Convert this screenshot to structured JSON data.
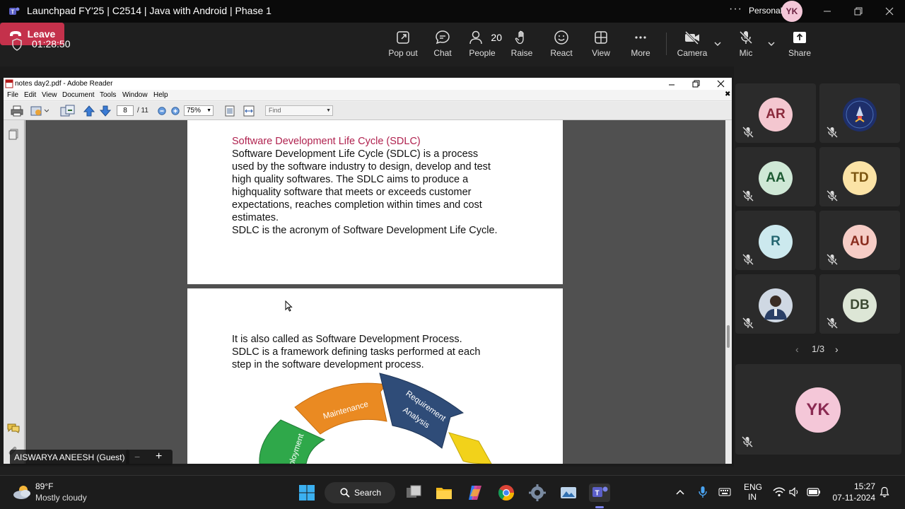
{
  "window": {
    "title": "Launchpad FY'25 | C2514 | Java with Android | Phase 1",
    "profile_label": "Personal",
    "profile_initials": "YK"
  },
  "meeting": {
    "timer": "01:28:50",
    "toolbar": {
      "popout": "Pop out",
      "chat": "Chat",
      "people": "People",
      "people_count": "20",
      "raise": "Raise",
      "react": "React",
      "view": "View",
      "more": "More",
      "camera": "Camera",
      "mic": "Mic",
      "share": "Share",
      "leave": "Leave"
    },
    "presenter_label": "AISWARYA ANEESH (Guest)"
  },
  "reader": {
    "title": "notes day2.pdf - Adobe Reader",
    "menu": [
      "File",
      "Edit",
      "View",
      "Document",
      "Tools",
      "Window",
      "Help"
    ],
    "page_current": "8",
    "page_total": "/ 11",
    "zoom": "75%",
    "find_placeholder": "Find",
    "page1": {
      "heading": "Software Development Life Cycle (SDLC)",
      "lines": [
        "Software Development Life Cycle (SDLC) is a process",
        "used by the software industry to design, develop and test",
        "high quality softwares. The SDLC aims to produce a",
        "highquality software that meets or exceeds customer",
        "expectations, reaches completion within times and cost",
        "estimates.",
        "SDLC is the acronym of Software Development Life Cycle."
      ]
    },
    "page2": {
      "lines": [
        "It is also called as Software Development Process.",
        "SDLC is a framework defining tasks performed at each",
        "step in the software development process."
      ],
      "diagram_labels": {
        "maintenance": "Maintenance",
        "requirement": "Requirement",
        "analysis": "Analysis",
        "deployment": "ployment"
      }
    }
  },
  "gallery": {
    "participants": [
      {
        "initials": "AR",
        "bg": "#f4c7d0",
        "fg": "#8a2a3c"
      },
      {
        "initials": "",
        "bg": "#1e2f6b",
        "fg": "#fff"
      },
      {
        "initials": "AA",
        "bg": "#cfe8d6",
        "fg": "#1d5a33"
      },
      {
        "initials": "TD",
        "bg": "#fbe3a6",
        "fg": "#7a5410"
      },
      {
        "initials": "R",
        "bg": "#cce9ee",
        "fg": "#246670"
      },
      {
        "initials": "AU",
        "bg": "#f6cdc6",
        "fg": "#8a2d1f"
      },
      {
        "initials": "",
        "bg": "#dfe6ef",
        "fg": "#333"
      },
      {
        "initials": "DB",
        "bg": "#dde6d6",
        "fg": "#3d4a33"
      }
    ],
    "pager": "1/3",
    "self_initials": "YK"
  },
  "taskbar": {
    "weather_temp": "89°F",
    "weather_desc": "Mostly cloudy",
    "search": "Search",
    "lang_1": "ENG",
    "lang_2": "IN",
    "time": "15:27",
    "date": "07-11-2024"
  }
}
